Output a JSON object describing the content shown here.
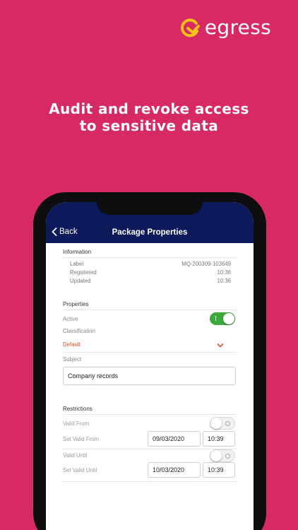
{
  "brand": {
    "name": "egress",
    "accent": "#f5c21b"
  },
  "headline": {
    "line1": "Audit and revoke access",
    "line2": "to sensitive data"
  },
  "colors": {
    "background": "#d82a62",
    "navbar": "#0c1a5c",
    "toggle_on": "#3aaa3a",
    "classification": "#e0522b"
  },
  "nav": {
    "back_label": "Back",
    "title": "Package Properties"
  },
  "information": {
    "title": "Information",
    "rows": [
      {
        "label": "Label",
        "value": "MQ-200309-103649"
      },
      {
        "label": "Registered",
        "value": "10:36"
      },
      {
        "label": "Updated",
        "value": "10:36"
      }
    ]
  },
  "properties": {
    "title": "Properties",
    "active_label": "Active",
    "active": true,
    "classification_label": "Classification",
    "classification_value": "Default",
    "subject_label": "Subject",
    "subject_value": "Company records"
  },
  "restrictions": {
    "title": "Restrictions",
    "valid_from_label": "Valid From",
    "valid_from_enabled": false,
    "set_valid_from_label": "Set Valid From",
    "valid_from_date": "09/03/2020",
    "valid_from_time": "10:39",
    "valid_until_label": "Valid Until",
    "valid_until_enabled": false,
    "set_valid_until_label": "Set Valid Until",
    "valid_until_date": "10/03/2020",
    "valid_until_time": "10:39"
  }
}
